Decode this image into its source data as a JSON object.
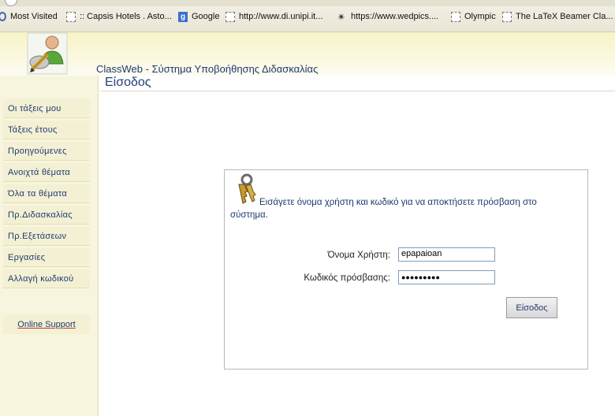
{
  "bookmarks": [
    {
      "label": "Most Visited",
      "icon": "most-visited-icon"
    },
    {
      "label": ":: Capsis Hotels . Asto...",
      "icon": "page-icon"
    },
    {
      "label": "Google",
      "icon": "google-icon"
    },
    {
      "label": "http://www.di.unipi.it...",
      "icon": "page-icon"
    },
    {
      "label": "https://www.wedpics....",
      "icon": "spark-icon"
    },
    {
      "label": "Olympic",
      "icon": "page-icon"
    },
    {
      "label": "The LaTeX Beamer Cla...",
      "icon": "page-icon"
    }
  ],
  "header": {
    "title": "ClassWeb - Σύστημα Υποβοήθησης Διδασκαλίας"
  },
  "page": {
    "title": "Είσοδος"
  },
  "sidebar": {
    "items": [
      {
        "label": "Οι τάξεις μου"
      },
      {
        "label": "Τάξεις έτους"
      },
      {
        "label": "Προηγούμενες"
      },
      {
        "label": "Ανοιχτά θέματα"
      },
      {
        "label": "Όλα τα θέματα"
      },
      {
        "label": "Πρ.Διδασκαλίας"
      },
      {
        "label": "Πρ.Εξετάσεων"
      },
      {
        "label": "Εργασίες"
      },
      {
        "label": "Αλλαγή κωδικού"
      }
    ],
    "online_support": "Online Support"
  },
  "login": {
    "message_line1": "Εισάγετε όνομα χρήστη και κωδικό για να αποκτήσετε πρόσβαση στο",
    "message_line2": "σύστημα.",
    "username_label": "Όνομα Χρήστη:",
    "username_value": "epapaioan",
    "password_label": "Κωδικός πρόσβασης:",
    "password_value": "●●●●●●●●●",
    "submit_label": "Είσοδος"
  }
}
